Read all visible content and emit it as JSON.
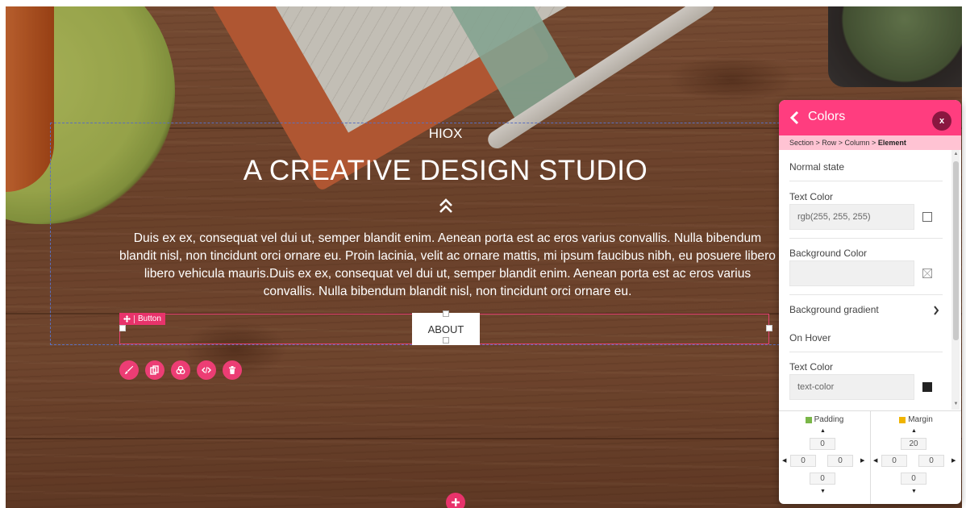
{
  "hero": {
    "eyebrow": "HIOX",
    "title": "A CREATIVE DESIGN STUDIO",
    "body": "Duis ex ex, consequat vel dui ut, semper blandit enim. Aenean porta est ac eros varius convallis. Nulla bibendum blandit nisl, non tincidunt orci ornare eu. Proin lacinia, velit ac ornare mattis, mi ipsum faucibus nibh, eu posuere libero libero vehicula mauris.Duis ex ex, consequat vel dui ut, semper blandit enim. Aenean porta est ac eros varius convallis. Nulla bibendum blandit nisl, non tincidunt orci ornare eu.",
    "button_label": "ABOUT"
  },
  "editor": {
    "row_tag": "Button",
    "tools": [
      "brush-icon",
      "copy-icon",
      "palette-icon",
      "code-icon",
      "trash-icon"
    ],
    "add_section": "plus-icon",
    "accent": "#e8336b"
  },
  "panel": {
    "title": "Colors",
    "close_label": "x",
    "breadcrumb": {
      "path": "Section > Row > Column > ",
      "current": "Element"
    },
    "normal_state": "Normal state",
    "text_color_label": "Text Color",
    "text_color_value": "rgb(255, 255, 255)",
    "bg_color_label": "Background Color",
    "bg_color_value": "",
    "bg_gradient_label": "Background gradient",
    "on_hover": "On Hover",
    "hover_text_color_label": "Text Color",
    "hover_text_color_value": "text-color",
    "header_color": "#ff3d7f",
    "padding": {
      "label": "Padding",
      "color": "#7ab648",
      "top": "0",
      "left": "0",
      "right": "0",
      "bottom": "0"
    },
    "margin": {
      "label": "Margin",
      "color": "#f0b400",
      "top": "20",
      "left": "0",
      "right": "0",
      "bottom": "0"
    }
  }
}
